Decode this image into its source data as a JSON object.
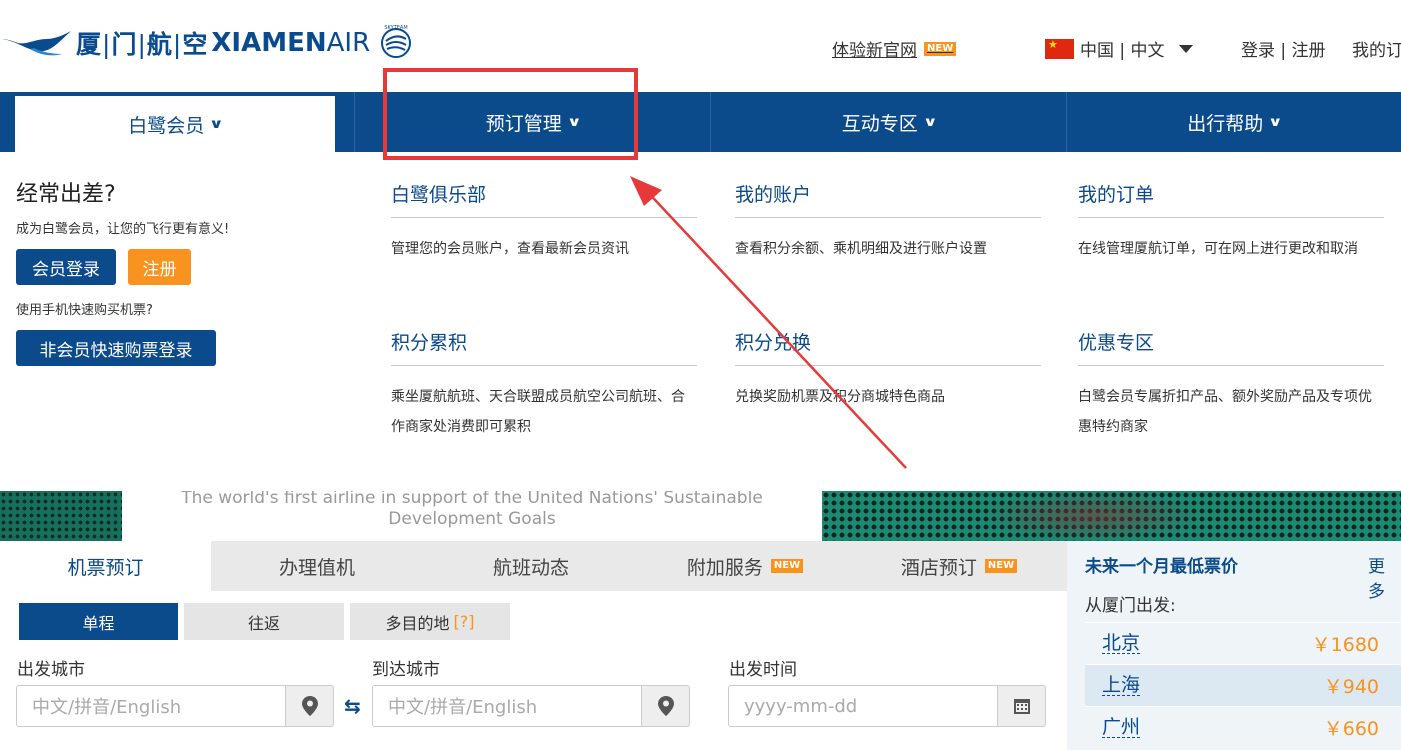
{
  "header": {
    "logo_cn": [
      "厦",
      "门",
      "航",
      "空"
    ],
    "logo_en_bold": "XIAMEN",
    "logo_en_thin": "AIR",
    "seal_text": "SKYTEAM",
    "new_site_link": "体验新官网",
    "new_badge": "NEW",
    "language": "中国 | 中文",
    "login": "登录 | 注册",
    "my_orders": "我的订"
  },
  "nav": {
    "items": [
      {
        "label": "白鹭会员",
        "chev": "⌄"
      },
      {
        "label": "预订管理",
        "chev": "⌄"
      },
      {
        "label": "互动专区",
        "chev": "⌄"
      },
      {
        "label": "出行帮助",
        "chev": "⌄"
      }
    ]
  },
  "member_panel": {
    "title": "经常出差?",
    "subtitle": "成为白鹭会员，让您的飞行更有意义!",
    "login_button": "会员登录",
    "register_button": "注册",
    "mobile_hint": "使用手机快速购买机票?",
    "guest_button": "非会员快速购票登录"
  },
  "menu": [
    {
      "title": "白鹭俱乐部",
      "desc": "管理您的会员账户，查看最新会员资讯"
    },
    {
      "title": "我的账户",
      "desc": "查看积分余额、乘机明细及进行账户设置"
    },
    {
      "title": "我的订单",
      "desc": "在线管理厦航订单，可在网上进行更改和取消"
    },
    {
      "title": "积分累积",
      "desc": "乘坐厦航航班、天合联盟成员航空公司航班、合作商家处消费即可累积"
    },
    {
      "title": "积分兑换",
      "desc": "兑换奖励机票及积分商城特色商品"
    },
    {
      "title": "优惠专区",
      "desc": "白鹭会员专属折扣产品、额外奖励产品及专项优惠特约商家"
    }
  ],
  "banner": {
    "line1": "The world's first airline in support of the United Nations' Sustainable",
    "line2": "Development Goals"
  },
  "booking": {
    "tabs": [
      {
        "label": "机票预订"
      },
      {
        "label": "办理值机"
      },
      {
        "label": "航班动态"
      },
      {
        "label": "附加服务",
        "badge": "NEW"
      },
      {
        "label": "酒店预订",
        "badge": "NEW"
      }
    ],
    "trip_types": [
      "单程",
      "往返",
      "多目的地"
    ],
    "trip_hint": "[?]",
    "from_label": "出发城市",
    "to_label": "到达城市",
    "date_label": "出发时间",
    "city_placeholder": "中文/拼音/English",
    "date_placeholder": "yyyy-mm-dd"
  },
  "fares": {
    "title": "未来一个月最低票价",
    "more": "更多",
    "from": "从厦门出发:",
    "rows": [
      {
        "city": "北京",
        "price": "￥1680"
      },
      {
        "city": "上海",
        "price": "￥940"
      },
      {
        "city": "广州",
        "price": "￥660"
      }
    ]
  },
  "colors": {
    "brand_blue": "#0b4a8b",
    "accent_orange": "#f7931e",
    "annotation_red": "#e63a3a"
  }
}
